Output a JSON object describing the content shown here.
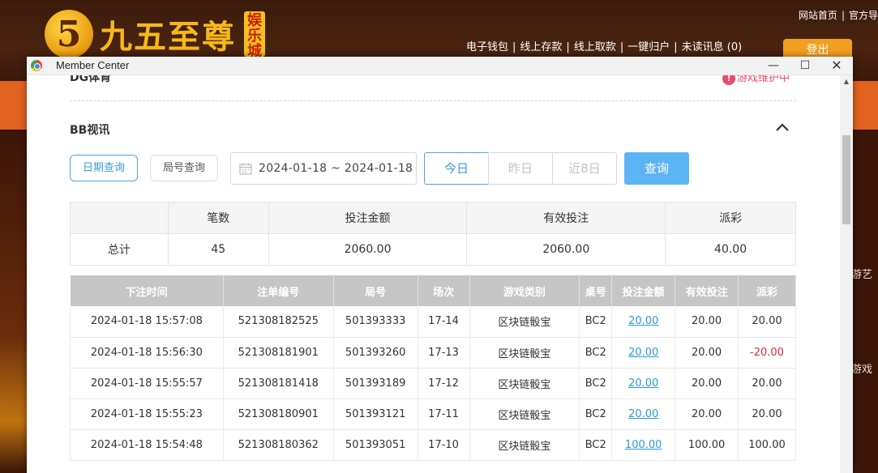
{
  "site": {
    "logo_numeral": "5",
    "logo_text": "九五至尊",
    "logo_badge": "娱乐城",
    "top_links": [
      "网站首页",
      "官方导"
    ],
    "nav_links": [
      "电子钱包",
      "线上存款",
      "线上取款",
      "一键归户",
      "未读讯息 (0)"
    ],
    "logout": "登出",
    "side_texts": [
      "游艺",
      "游戏"
    ]
  },
  "window": {
    "title": "Member Center",
    "controls": {
      "minimize": "—",
      "maximize": "☐",
      "close": "✕"
    }
  },
  "dg": {
    "title": "DG体育",
    "status": "游戏维护中",
    "status_icon": "!"
  },
  "bb": {
    "title": "BB视讯"
  },
  "filters": {
    "date_query": "日期查询",
    "round_query": "局号查询",
    "date_range": "2024-01-18 ~ 2024-01-18",
    "today": "今日",
    "yesterday": "昨日",
    "last8": "近8日",
    "query": "查询"
  },
  "summary": {
    "headers": [
      "",
      "笔数",
      "投注金额",
      "有效投注",
      "派彩"
    ],
    "row": [
      "总计",
      "45",
      "2060.00",
      "2060.00",
      "40.00"
    ]
  },
  "records": {
    "headers": [
      "下注时间",
      "注单编号",
      "局号",
      "场次",
      "游戏类别",
      "桌号",
      "投注金额",
      "有效投注",
      "派彩"
    ],
    "rows": [
      [
        "2024-01-18 15:57:08",
        "521308182525",
        "501393333",
        "17-14",
        "区块链骰宝",
        "BC2",
        "20.00",
        "20.00",
        "20.00"
      ],
      [
        "2024-01-18 15:56:30",
        "521308181901",
        "501393260",
        "17-13",
        "区块链骰宝",
        "BC2",
        "20.00",
        "20.00",
        "-20.00"
      ],
      [
        "2024-01-18 15:55:57",
        "521308181418",
        "501393189",
        "17-12",
        "区块链骰宝",
        "BC2",
        "20.00",
        "20.00",
        "20.00"
      ],
      [
        "2024-01-18 15:55:23",
        "521308180901",
        "501393121",
        "17-11",
        "区块链骰宝",
        "BC2",
        "20.00",
        "20.00",
        "20.00"
      ],
      [
        "2024-01-18 15:54:48",
        "521308180362",
        "501393051",
        "17-10",
        "区块链骰宝",
        "BC2",
        "100.00",
        "100.00",
        "100.00"
      ]
    ]
  },
  "colors": {
    "accent": "#5cb5f3",
    "negative": "#e0283a",
    "maintenance": "#f0486b",
    "brand_orange": "#f2a020"
  }
}
